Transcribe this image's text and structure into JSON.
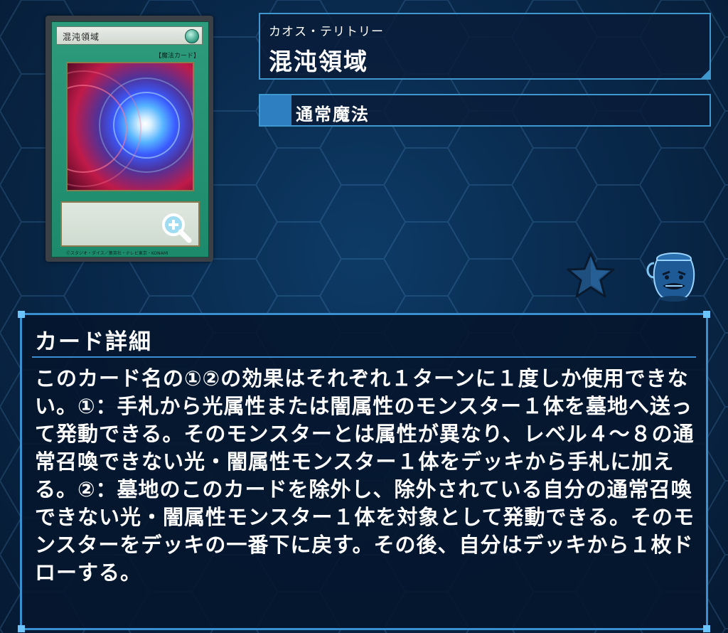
{
  "card": {
    "name": "混沌領域",
    "type_bracket": "【魔法カード】",
    "footer": "Ⓒスタジオ・ダイス／集英社・テレビ東京・KONAMI"
  },
  "name_panel": {
    "kana": "カオス・テリトリー",
    "title": "混沌領域"
  },
  "type_panel": {
    "label": "通常魔法"
  },
  "icons": {
    "zoom": "zoom-in-icon",
    "favorite": "star-icon",
    "pot": "pot-of-greed-icon"
  },
  "detail": {
    "header": "カード詳細",
    "text": "このカード名の①②の効果はそれぞれ１ターンに１度しか使用できない。①：手札から光属性または闇属性のモンスター１体を墓地へ送って発動できる。そのモンスターとは属性が異なり、レベル４～８の通常召喚できない光・闇属性モンスター１体をデッキから手札に加える。②：墓地のこのカードを除外し、除外されている自分の通常召喚できない光・闇属性モンスター１体を対象として発動できる。そのモンスターをデッキの一番下に戻す。その後、自分はデッキから１枚ドローする。"
  },
  "colors": {
    "background": "#092a4d",
    "panel_border": "#3f97cf",
    "type_square": "#2e7fc1",
    "card_frame": "#1c8a6b"
  }
}
